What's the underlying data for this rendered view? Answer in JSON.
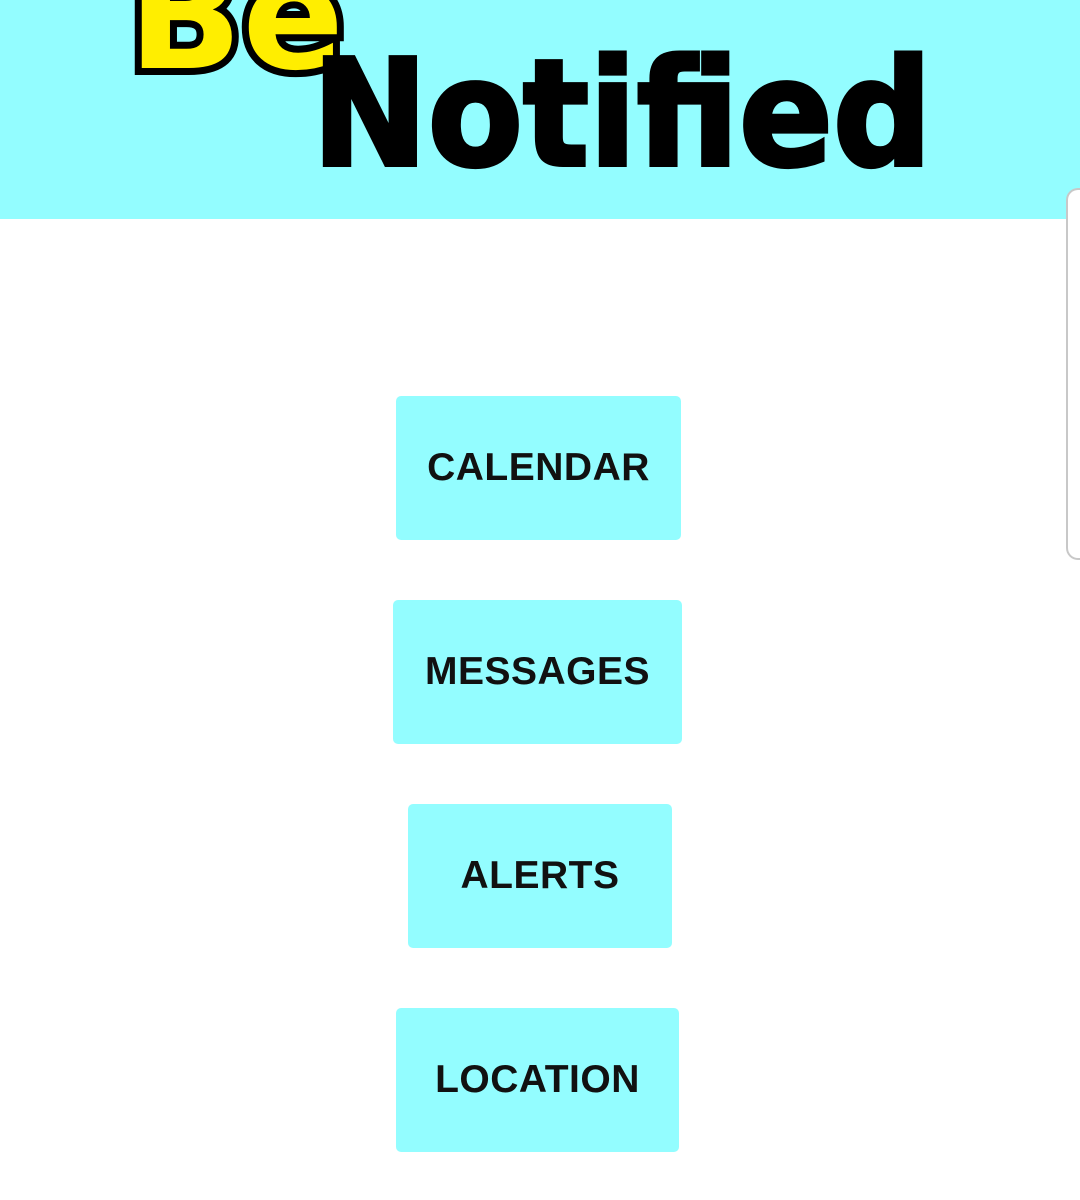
{
  "header": {
    "logo_text_partial": "Be",
    "logo_text": "Notified",
    "background_color": "#93fdff",
    "logo_accent_color": "#ffee00"
  },
  "buttons": [
    {
      "id": "calendar",
      "label": "CALENDAR"
    },
    {
      "id": "messages",
      "label": "MESSAGES"
    },
    {
      "id": "alerts",
      "label": "ALERTS"
    },
    {
      "id": "location",
      "label": "LOCATION"
    }
  ],
  "colors": {
    "button_background": "#93fdff",
    "button_text": "#111111",
    "page_background": "#ffffff"
  }
}
